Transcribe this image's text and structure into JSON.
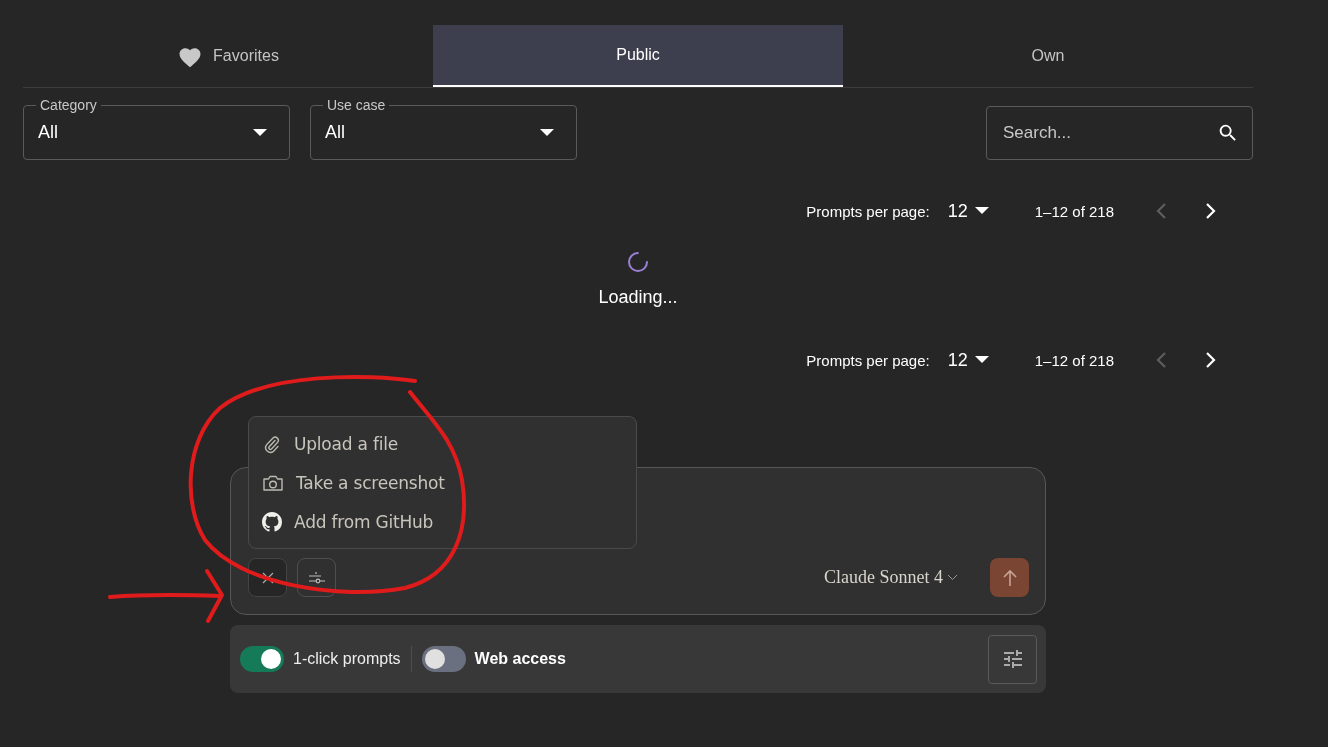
{
  "tabs": [
    {
      "kind": "favorites",
      "label": "Favorites",
      "selected": false
    },
    {
      "kind": "plain",
      "label": "Public",
      "selected": true
    },
    {
      "kind": "plain",
      "label": "Own",
      "selected": false
    }
  ],
  "filters": [
    {
      "label": "Category",
      "value": "All"
    },
    {
      "label": "Use case",
      "value": "All"
    }
  ],
  "search": {
    "placeholder": "Search..."
  },
  "pagination_top": {
    "label": "Prompts per page:",
    "per_page": "12",
    "range": "1–12 of 218",
    "prev_disabled": true
  },
  "loading": {
    "text": "Loading..."
  },
  "pagination_bottom": {
    "label": "Prompts per page:",
    "per_page": "12",
    "range": "1–12 of 218",
    "prev_disabled": true
  },
  "attach_menu": {
    "items": [
      {
        "kind": "file",
        "label": "Upload a file"
      },
      {
        "kind": "camera",
        "label": "Take a screenshot"
      },
      {
        "kind": "github",
        "label": "Add from GitHub"
      }
    ]
  },
  "composer": {
    "model": "Claude Sonnet 4"
  },
  "toolbar": {
    "toggles": [
      {
        "label": "1-click prompts",
        "on": true
      },
      {
        "label": "Web access",
        "on": false
      }
    ]
  }
}
